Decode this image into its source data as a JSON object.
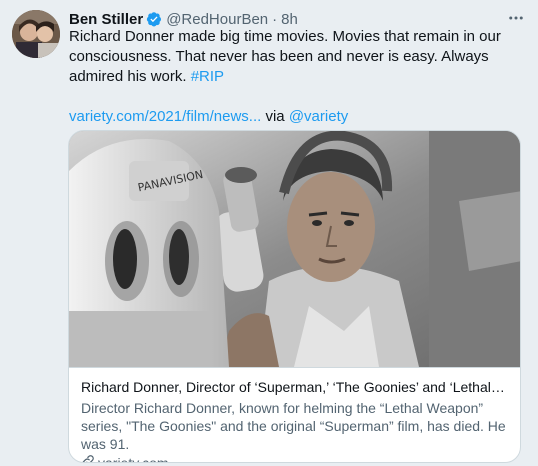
{
  "author": {
    "name": "Ben Stiller",
    "handle": "@RedHourBen",
    "separator": "·",
    "time": "8h",
    "avatar_icon": "avatar-photo"
  },
  "tweet": {
    "text": "Richard Donner made big time movies. Movies that remain in our consciousness. That never has been and never is easy. Always admired his work.",
    "hashtag": "#RIP",
    "link_text": "variety.com/2021/film/news...",
    "via_text": "via",
    "via_handle": "@variety"
  },
  "card": {
    "title": "Richard Donner, Director of ‘Superman,’ ‘The Goonies’ and ‘Lethal Wea...",
    "description": "Director Richard Donner, known for helming the “Lethal Weapon” series, \"The Goonies\" and the original “Superman” film, has died. He was 91.",
    "domain": "variety.com",
    "image_icon": "photo-of-man-with-camera"
  },
  "colors": {
    "link": "#1d9bf0",
    "secondary_text": "#536471",
    "background": "#e9eef2",
    "verified": "#1d9bf0"
  }
}
